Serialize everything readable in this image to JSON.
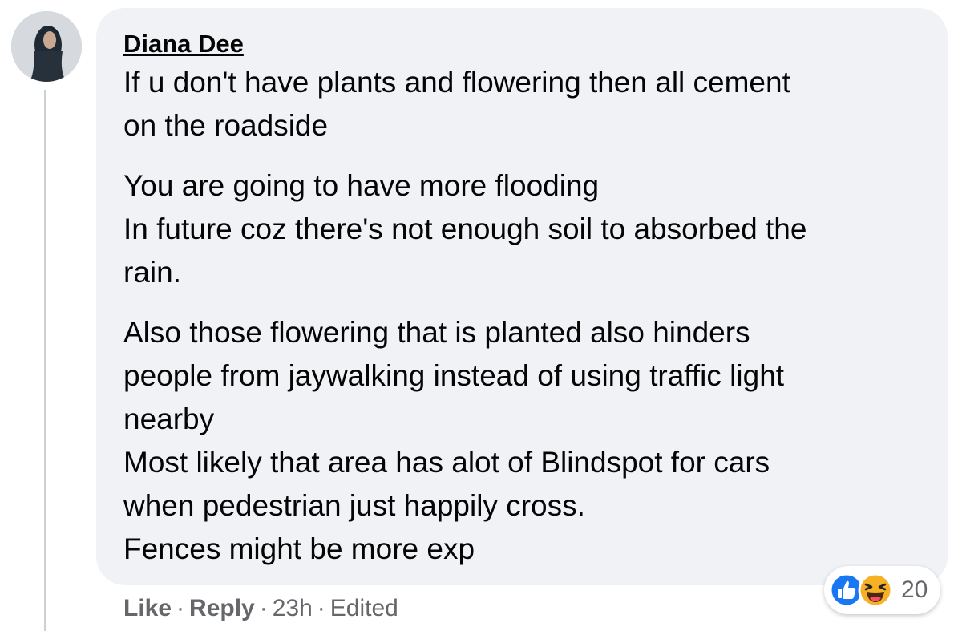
{
  "comment": {
    "author": "Diana Dee",
    "paragraphs": [
      [
        "If u don't have plants and flowering then all cement",
        "on the roadside"
      ],
      [
        "You are going to have more flooding",
        "In future coz there's not enough soil to absorbed the",
        "rain."
      ],
      [
        "Also those flowering that is planted also hinders",
        "people from jaywalking instead of using traffic light",
        "nearby",
        "Most likely that area has alot of Blindspot for cars",
        "when pedestrian just happily cross.",
        "Fences might be more exp"
      ]
    ]
  },
  "actions": {
    "like": "Like",
    "reply": "Reply",
    "time": "23h",
    "edited": "Edited",
    "separator": "·"
  },
  "reactions": {
    "icons": [
      "like-icon",
      "haha-icon"
    ],
    "count": "20"
  },
  "colors": {
    "bubble": "#f0f2f5",
    "text": "#050505",
    "meta": "#65676b",
    "like_blue": "#1877f2",
    "haha_yellow": "#f7b125"
  }
}
